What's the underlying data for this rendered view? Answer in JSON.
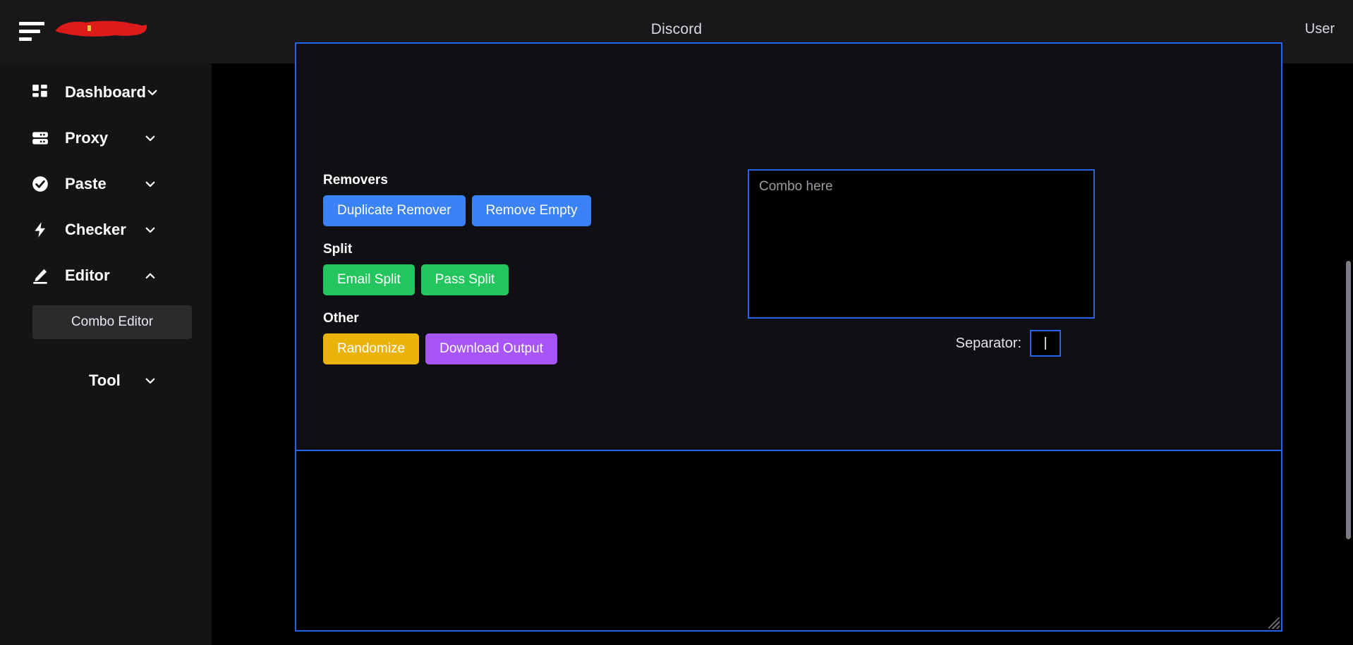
{
  "topbar": {
    "menu_icon": "hamburger-icon",
    "brand_redaction_color": "#dd1b1b",
    "title": "Discord",
    "user_label": "User"
  },
  "sidebar": {
    "items": [
      {
        "label": "Dashboard",
        "icon": "grid-icon",
        "chevron": "chevron-down-icon"
      },
      {
        "label": "Proxy",
        "icon": "server-icon",
        "chevron": "chevron-down-icon"
      },
      {
        "label": "Paste",
        "icon": "check-circle-icon",
        "chevron": "chevron-down-icon"
      },
      {
        "label": "Checker",
        "icon": "bolt-icon",
        "chevron": "chevron-down-icon"
      },
      {
        "label": "Editor",
        "icon": "pencil-icon",
        "chevron": "chevron-up-icon"
      },
      {
        "label": "Tool",
        "icon": "",
        "chevron": "chevron-down-icon"
      }
    ],
    "subitem": {
      "label": "Combo Editor"
    }
  },
  "tools": {
    "groups": [
      {
        "title": "Removers",
        "buttons": [
          {
            "label": "Duplicate Remover",
            "color": "#3b82f6"
          },
          {
            "label": "Remove Empty",
            "color": "#3b82f6"
          }
        ]
      },
      {
        "title": "Split",
        "buttons": [
          {
            "label": "Email Split",
            "color": "#22c55e"
          },
          {
            "label": "Pass Split",
            "color": "#22c55e"
          }
        ]
      },
      {
        "title": "Other",
        "buttons": [
          {
            "label": "Randomize",
            "color": "#eab308"
          },
          {
            "label": "Download Output",
            "color": "#a855f7"
          }
        ]
      }
    ]
  },
  "combo": {
    "placeholder": "Combo here",
    "value": "",
    "separator_label": "Separator:",
    "separator_value": "|"
  },
  "output": {
    "value": ""
  },
  "colors": {
    "accent_border": "#2563eb",
    "panel_bg": "#0f1014",
    "page_bg": "#000000",
    "sidebar_bg": "#141416",
    "topbar_bg": "#18181a"
  }
}
